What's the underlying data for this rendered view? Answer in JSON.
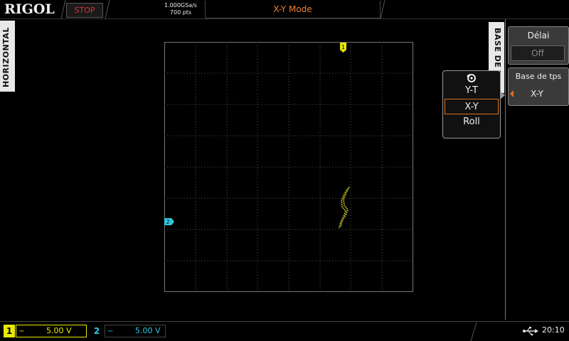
{
  "brand": "RIGOL",
  "run_status": "STOP",
  "sample_rate": "1.000GSa/s",
  "memory_depth": "700  pts",
  "mode_title": "X-Y Mode",
  "left_tab": "HORIZONTAL",
  "right_tab": "BASE DE TEMPS",
  "menu": {
    "delay_label": "Délai",
    "delay_value": "Off",
    "timebase_label": "Base de tps",
    "timebase_value": "X-Y"
  },
  "popup": {
    "items": [
      "Y-T",
      "X-Y",
      "Roll"
    ],
    "selected": "X-Y"
  },
  "markers": {
    "ch1": "1",
    "ch2": "2"
  },
  "channels": [
    {
      "number": "1",
      "coupling": "DC",
      "scale": "5.00 V",
      "color": "#e8e800"
    },
    {
      "number": "2",
      "coupling": "DC",
      "scale": "5.00 V",
      "color": "#2ec8e0"
    }
  ],
  "clock": "20:10",
  "colors": {
    "accent": "#e07020",
    "ch1": "#e8e800",
    "ch2": "#2ec8e0",
    "stop": "#e03030"
  }
}
